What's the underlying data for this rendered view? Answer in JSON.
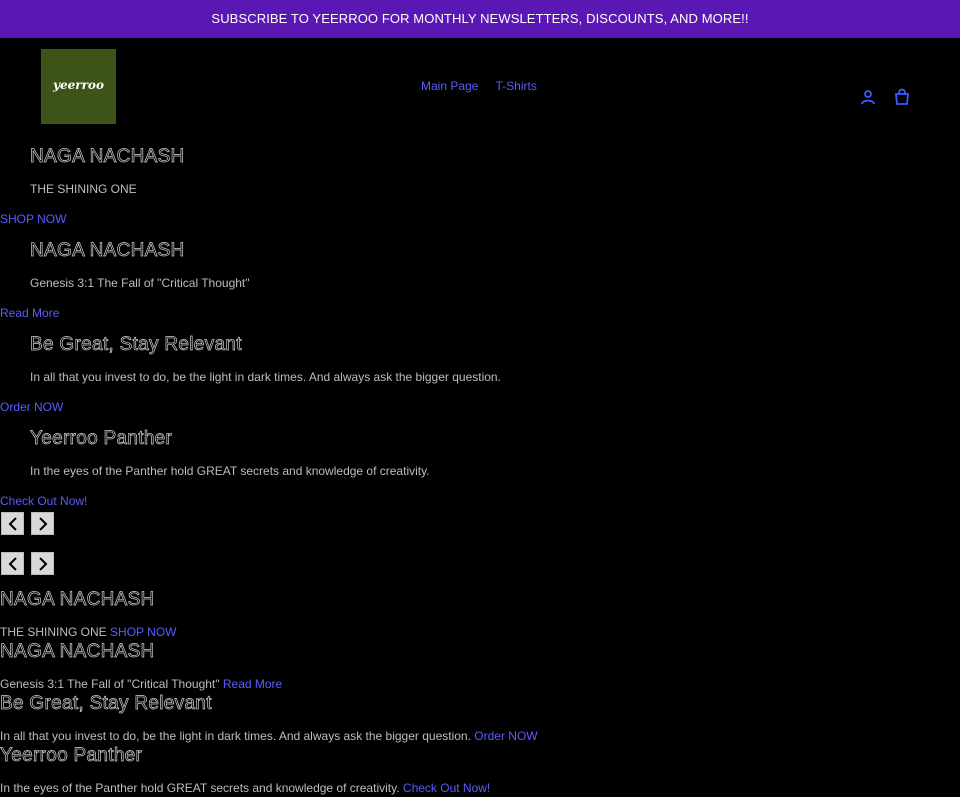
{
  "announcement": "SUBSCRIBE TO YEERROO FOR MONTHLY NEWSLETTERS, DISCOUNTS, AND MORE!!",
  "logo": "yeerroo",
  "nav": {
    "items": [
      "Main Page",
      "T-Shirts"
    ]
  },
  "header_icons": [
    "user-icon",
    "cart-icon"
  ],
  "colors": {
    "announcement_bg": "#5b17b3",
    "logo_bg": "#3e5318",
    "link": "#5b5bff"
  },
  "slides": [
    {
      "title": "NAGA NACHASH",
      "subtitle": "THE SHINING ONE",
      "link": "SHOP NOW"
    },
    {
      "title": "NAGA NACHASH",
      "subtitle": "Genesis 3:1 The Fall of \"Critical Thought\"",
      "link": "Read More"
    },
    {
      "title": "Be Great, Stay Relevant",
      "subtitle": "In all that you invest to do, be the light in dark times. And always ask the bigger question.",
      "link": "Order NOW"
    },
    {
      "title": "Yeerroo Panther",
      "subtitle": "In the eyes of the Panther hold GREAT secrets and knowledge of creativity.",
      "link": "Check Out Now!"
    }
  ]
}
